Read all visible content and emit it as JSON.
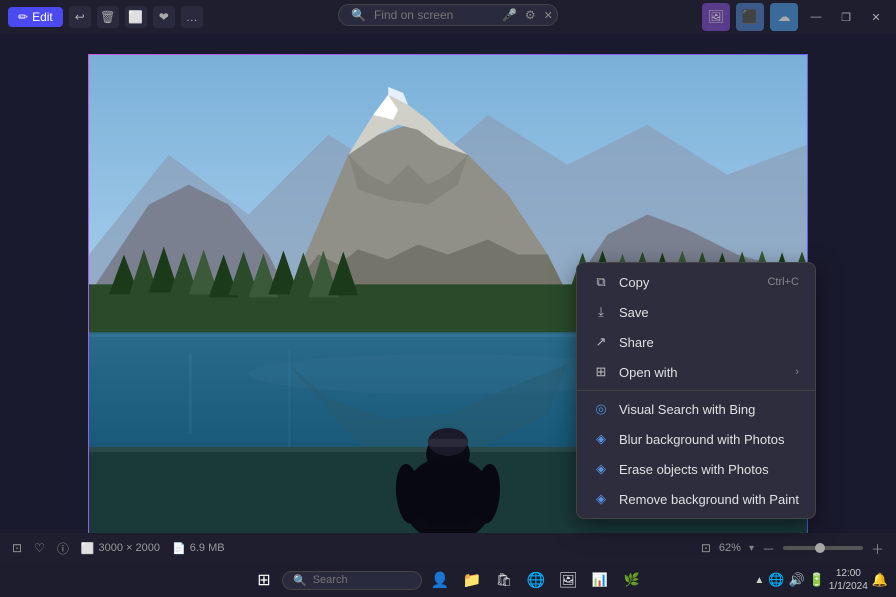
{
  "titleBar": {
    "editLabel": "Edit",
    "icons": [
      "↩",
      "🗑",
      "⬜",
      "✦",
      "…"
    ]
  },
  "searchBar": {
    "placeholder": "Find on screen"
  },
  "windowControls": {
    "minimize": "—",
    "maximize": "❐",
    "close": "✕"
  },
  "contextMenu": {
    "items": [
      {
        "id": "copy",
        "label": "Copy",
        "shortcut": "Ctrl+C",
        "icon": "⧉",
        "hasArrow": false
      },
      {
        "id": "save",
        "label": "Save",
        "shortcut": "",
        "icon": "💾",
        "hasArrow": false
      },
      {
        "id": "share",
        "label": "Share",
        "shortcut": "",
        "icon": "↗",
        "hasArrow": false
      },
      {
        "id": "open-with",
        "label": "Open with",
        "shortcut": "",
        "icon": "⊞",
        "hasArrow": true
      },
      {
        "id": "visual-search",
        "label": "Visual Search with Bing",
        "shortcut": "",
        "icon": "⟳",
        "hasArrow": false
      },
      {
        "id": "blur-bg",
        "label": "Blur background with Photos",
        "shortcut": "",
        "icon": "◈",
        "hasArrow": false
      },
      {
        "id": "erase-objects",
        "label": "Erase objects with Photos",
        "shortcut": "",
        "icon": "◈",
        "hasArrow": false
      },
      {
        "id": "remove-bg",
        "label": "Remove background with Paint",
        "shortcut": "",
        "icon": "◈",
        "hasArrow": false
      }
    ]
  },
  "statusBar": {
    "dimensions": "3000 × 2000",
    "fileSize": "6.9 MB",
    "zoom": "62%"
  },
  "taskbar": {
    "searchPlaceholder": "Search",
    "time": "12:00",
    "date": "1/1/2024",
    "icons": [
      "⊞",
      "🔍",
      "👤",
      "📁",
      "🛒",
      "🌐",
      "📎",
      "🖼",
      "📊"
    ]
  }
}
